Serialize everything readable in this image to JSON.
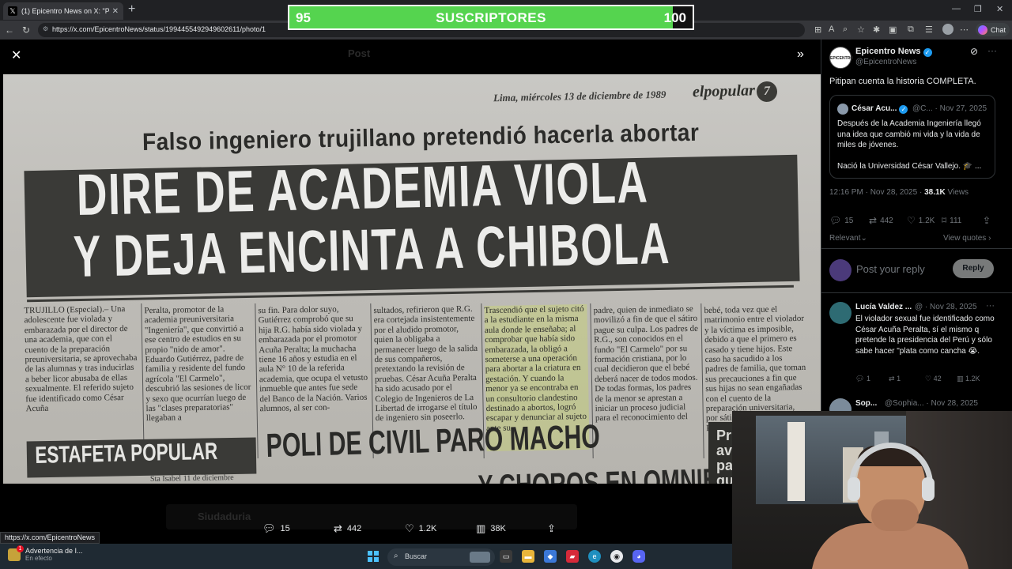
{
  "browser": {
    "tab_title": "(1) Epicentro News on X: \"Pitipan cuenta",
    "url": "https://x.com/EpicentroNews/status/1994455492949602611/photo/1",
    "chat_label": "Chat",
    "status_url": "https://x.com/EpicentroNews"
  },
  "overlay": {
    "current": "95",
    "label": "SUSCRIPTORES",
    "goal": "100",
    "progress_fraction": 0.95,
    "fill_color": "#55d44f"
  },
  "newspaper": {
    "date": "Lima, miércoles 13 de diciembre de 1989",
    "brand": "elpopular",
    "page": "7",
    "kicker": "Falso ingeniero trujillano pretendió hacerla abortar",
    "headline_1": "DIRE DE ACADEMIA VIOLA",
    "headline_2": "Y DEJA ENCINTA A CHIBOLA",
    "col1": "TRUJILLO (Especial).– Una adolescente fue violada y embarazada por el director de una academia, que con el cuento de la preparación preuniversitaria, se aprovechaba de las alumnas y tras inducirlas a beber licor abusaba de ellas sexualmente. El referido sujeto fue identificado como César Acuña",
    "col2": "Peralta, promotor de la academia preuniversitaria \"Ingeniería\", que convirtió a ese centro de estudios en su propio \"nido de amor\". Eduardo Gutiérrez, padre de familia y residente del fundo agrícola \"El Carmelo\", descubrió las sesiones de licor y sexo que ocurrían luego de las \"clases preparatorias\" llegaban a",
    "col3": "su fin. Para dolor suyo, Gutiérrez comprobó que su hija R.G. había sido violada y embarazada por el promotor Acuña Peralta; la muchacha tiene 16 años y estudia en el aula N° 10 de la referida academia, que ocupa el vetusto inmueble que antes fue sede del Banco de la Nación. Varios alumnos, al ser con-",
    "col4": "sultados, refirieron que R.G. era cortejada insistentemente por el aludido promotor, quien la obligaba a permanecer luego de la salida de sus compañeros, pretextando la revisión de pruebas. César Acuña Peralta ha sido acusado por el Colegio de Ingenieros de La Libertad de irrogarse el título de ingeniero sin poseerlo.",
    "col5": "Trascendió que el sujeto citó a la estudiante en la misma aula donde le enseñaba; al comprobar que había sido embarazada, la obligó a someterse a una operación para abortar a la criatura en gestación. Y cuando la menor ya se encontraba en un consultorio clandestino destinado a abortos, logró escapar y denunciar al sujeto ante su",
    "col6": "padre, quien de inmediato se movilizó a fin de que el sátiro pague su culpa. Los padres de R.G., son conocidos en el fundo \"El Carmelo\" por su formación cristiana, por lo cual decidieron que el bebé deberá nacer de todos modos. De todas formas, los padres de la menor se aprestan a iniciar un proceso judicial para el reconocimiento del",
    "col7": "bebé, toda vez que el matrimonio entre el violador y la víctima es imposible, debido a que el primero es casado y tiene hijos. Este caso ha sacudido a los padres de familia, que toman sus precauciones a fin que sus hijas no sean engañadas con el cuento de la preparación universitaria, por sátiros como Acuña Peralta.",
    "section_tag": "ESTAFETA POPULAR",
    "subhead_1": "POLI DE CIVIL PARO MACHO",
    "subhead_2": "Y CHOROS EN OMNIBUS",
    "small_dateline": "Sta Isabel 11 de diciembre",
    "right_box": "Pr\nav\npa\nqu"
  },
  "viewer_actions": {
    "replies": "15",
    "reposts": "442",
    "likes": "1.2K",
    "views": "38K"
  },
  "ghost": {
    "post_label": "Post",
    "bottom_name": "Siudaduria"
  },
  "tweet": {
    "avatar_text": "EPICENTRO",
    "author": "Epicentro News",
    "handle": "@EpicentroNews",
    "text": "Pitipan cuenta la historia COMPLETA.",
    "quote": {
      "author": "César Acu...",
      "meta": "@C... · Nov 27, 2025",
      "text": "Después de la Academia Ingeniería llegó una idea que cambió mi vida y la vida de miles de jóvenes.",
      "text2": "Nació la Universidad César Vallejo. 🎓 ..."
    },
    "time": "12:16 PM · Nov 28, 2025 · ",
    "views_count": "38.1K",
    "views_label": "Views",
    "stats": {
      "replies": "15",
      "reposts": "442",
      "likes": "1.2K",
      "views": "111"
    },
    "relevant_label": "Relevant",
    "view_quotes_label": "View quotes",
    "reply_placeholder": "Post your reply",
    "reply_button": "Reply"
  },
  "replies": [
    {
      "author": "Lucía Valdez ...",
      "meta": "@ · Nov 28, 2025",
      "text": "El violador sexual fue identificado como César Acuña Peralta, sí el mismo q pretende la presidencia del Perú y sólo sabe hacer \"plata como cancha 😭.",
      "stats": {
        "replies": "1",
        "reposts": "1",
        "likes": "42",
        "views": "1.2K"
      }
    },
    {
      "author": "Sop...",
      "meta": "@Sophia... · Nov 28, 2025"
    }
  ],
  "taskbar": {
    "notif_title": "Advertencia de I...",
    "notif_sub": "En efecto",
    "search_label": "Buscar"
  },
  "icons": {
    "close": "close-icon",
    "expand": "expand-icon",
    "reply": "reply-icon",
    "repost": "repost-icon",
    "like": "heart-icon",
    "views": "views-icon",
    "share": "share-icon"
  }
}
